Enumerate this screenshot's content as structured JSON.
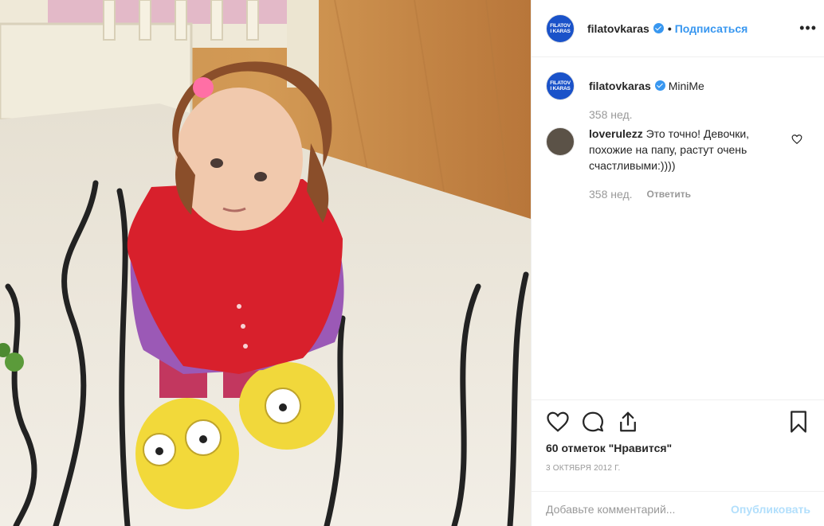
{
  "header": {
    "username": "filatovkaras",
    "separator": "•",
    "follow_label": "Подписаться",
    "more_label": "•••",
    "avatar_lines": [
      "FILATOV",
      "I KARAS"
    ]
  },
  "comments": [
    {
      "username": "filatovkaras",
      "text": "MiniMe",
      "time": "358 нед."
    },
    {
      "username": "loverulezz",
      "text": "Это точно! Девочки, похожие на папу, растут очень счастливыми:))))",
      "time": "358 нед.",
      "reply_label": "Ответить"
    }
  ],
  "actions": {
    "likes_text": "60 отметок \"Нравится\"",
    "date_text": "3 октября 2012 г."
  },
  "add_comment": {
    "placeholder": "Добавьте комментарий...",
    "publish_label": "Опубликовать"
  },
  "colors": {
    "accent": "#3897f0",
    "muted": "#999999",
    "publish_disabled": "#b2dffc"
  }
}
